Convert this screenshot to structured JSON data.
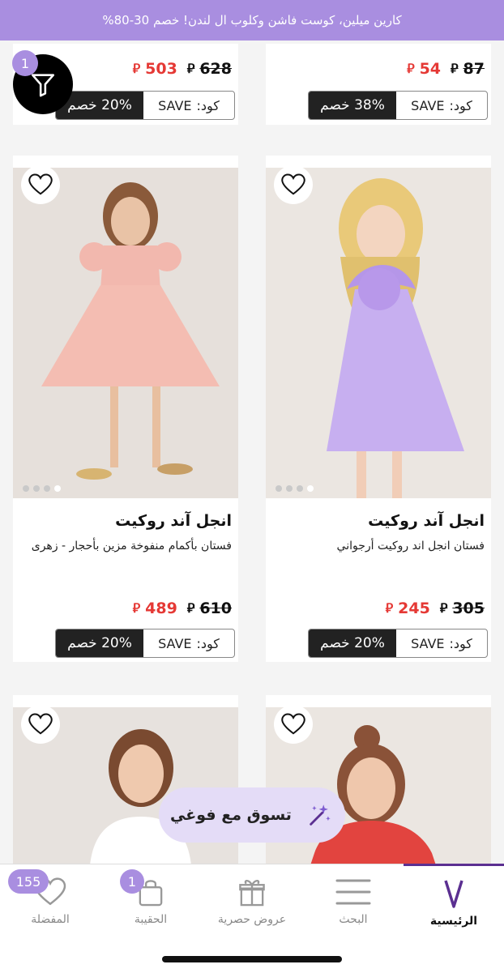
{
  "promo": {
    "text": "كارين ميلين، كوست فاشن وكلوب ال لندن! خصم 30-80%"
  },
  "currency_symbol": "⃁",
  "filter": {
    "badge": "1"
  },
  "top_row": [
    {
      "sale_price": "54",
      "original_price": "87",
      "discount": "38% خصم",
      "code_label": "كود:",
      "code": "SAVE"
    },
    {
      "sale_price": "503",
      "original_price": "628",
      "discount": "20% خصم",
      "code_label": "كود:",
      "code": "SAVE"
    }
  ],
  "products": [
    {
      "brand": "انجل آند روكيت",
      "description": "فستان انجل اند روكيت أرجواني",
      "sale_price": "245",
      "original_price": "305",
      "discount": "20% خصم",
      "code_label": "كود:",
      "code": "SAVE"
    },
    {
      "brand": "انجل آند روكيت",
      "description": "فستان بأكمام منفوخة مزين بأحجار - زهرى",
      "sale_price": "489",
      "original_price": "610",
      "discount": "20% خصم",
      "code_label": "كود:",
      "code": "SAVE"
    }
  ],
  "vogi_button": {
    "label": "تسوق مع فوغي"
  },
  "tabs": [
    {
      "label": "الرئيسية",
      "icon": "brand-v-icon"
    },
    {
      "label": "البحث",
      "icon": "menu-icon"
    },
    {
      "label": "عروض حصرية",
      "icon": "gift-icon"
    },
    {
      "label": "الحقيبة",
      "icon": "bag-icon",
      "badge": "1"
    },
    {
      "label": "المفضلة",
      "icon": "heart-icon",
      "badge": "155"
    }
  ],
  "colors": {
    "accent": "#a98ee0",
    "sale": "#e53935",
    "brand": "#5b2f91"
  }
}
